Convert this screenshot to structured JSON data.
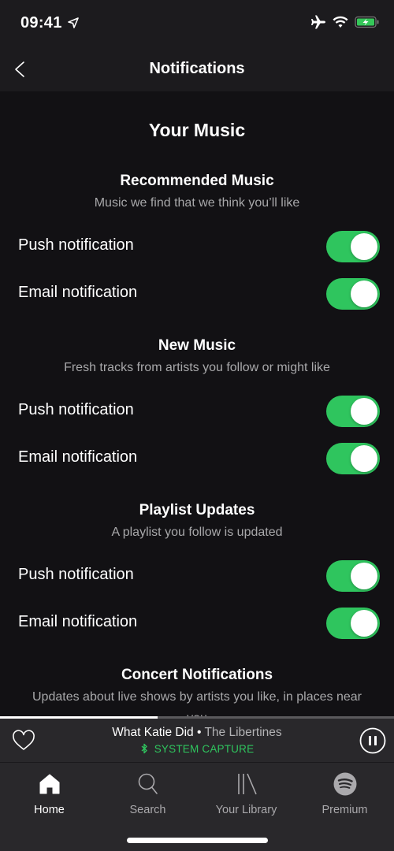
{
  "status_bar": {
    "time": "09:41",
    "icons": [
      "location-arrow-icon",
      "airplane-mode-icon",
      "wifi-icon",
      "battery-charging-icon"
    ]
  },
  "header": {
    "title": "Notifications",
    "back_icon": "chevron-left-icon"
  },
  "page_heading": "Your Music",
  "sections": [
    {
      "title": "Recommended Music",
      "subtitle": "Music we find that we think you’ll like",
      "rows": [
        {
          "label": "Push notification",
          "enabled": true
        },
        {
          "label": "Email notification",
          "enabled": true
        }
      ]
    },
    {
      "title": "New Music",
      "subtitle": "Fresh tracks from artists you follow or might like",
      "rows": [
        {
          "label": "Push notification",
          "enabled": true
        },
        {
          "label": "Email notification",
          "enabled": true
        }
      ]
    },
    {
      "title": "Playlist Updates",
      "subtitle": "A playlist you follow is updated",
      "rows": [
        {
          "label": "Push notification",
          "enabled": true
        },
        {
          "label": "Email notification",
          "enabled": true
        }
      ]
    },
    {
      "title": "Concert Notifications",
      "subtitle": "Updates about live shows by artists you like, in places near you",
      "rows": []
    }
  ],
  "player": {
    "progress_fraction": 0.4,
    "track_title": "What Katie Did",
    "separator": " • ",
    "artist": "The Libertines",
    "device_label": "SYSTEM CAPTURE",
    "device_icon": "bluetooth-icon",
    "like_icon": "heart-outline-icon",
    "control_icon": "pause-circle-icon"
  },
  "tabs": [
    {
      "label": "Home",
      "icon": "home-icon",
      "active": true
    },
    {
      "label": "Search",
      "icon": "search-icon",
      "active": false
    },
    {
      "label": "Your Library",
      "icon": "library-icon",
      "active": false
    },
    {
      "label": "Premium",
      "icon": "spotify-logo-icon",
      "active": false
    }
  ],
  "colors": {
    "accent_green": "#2fc55e",
    "background": "#121114",
    "header_bg": "#1c1b1e",
    "player_bg": "#29282b",
    "subtitle_gray": "#a8a8aa"
  }
}
